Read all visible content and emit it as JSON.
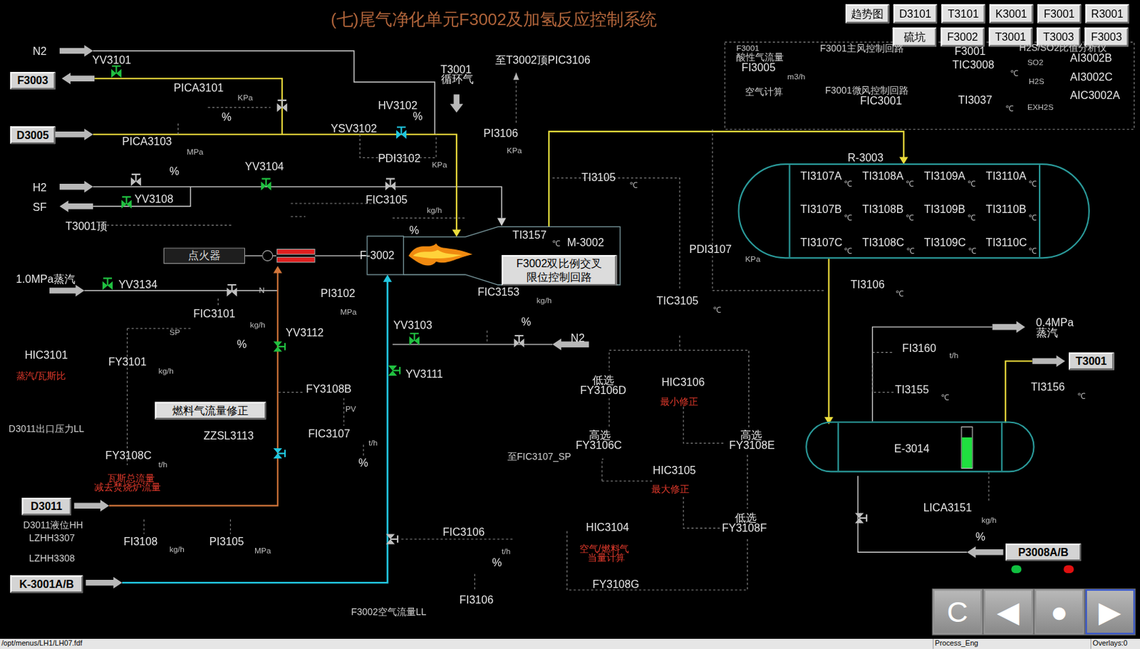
{
  "title": "(七)尾气净化单元F3002及加氢反应控制系统",
  "nav": [
    [
      "趋势图",
      "D3101",
      "T3101",
      "K3001",
      "F3001",
      "R3001"
    ],
    [
      "硫坑",
      "F3002",
      "T3001",
      "T3003",
      "F3003"
    ]
  ],
  "boxes": [
    {
      "lines": [
        "F3003"
      ],
      "kind": "stream"
    },
    {
      "lines": [
        "D3005"
      ],
      "kind": "stream"
    },
    {
      "lines": [
        "D3011"
      ],
      "kind": "stream"
    },
    {
      "lines": [
        "K-3001A/B"
      ],
      "kind": "stream"
    },
    {
      "lines": [
        "T3001"
      ],
      "kind": "stream"
    },
    {
      "lines": [
        "P3008A/B"
      ],
      "kind": "stream"
    },
    {
      "lines": [
        "点火器"
      ],
      "kind": "dark"
    },
    {
      "lines": [
        "燃料气流量修正"
      ],
      "kind": "light"
    },
    {
      "lines": [
        "F3002双比例交叉",
        "限位控制回路"
      ],
      "kind": "light"
    }
  ],
  "labels": [
    {
      "text": "N2",
      "kind": "tag"
    },
    {
      "text": "YV3101",
      "kind": "tag"
    },
    {
      "text": "PICA3101",
      "kind": "tag"
    },
    {
      "text": "KPa",
      "kind": "unit"
    },
    {
      "text": "%",
      "kind": "tag"
    },
    {
      "text": "PICA3103",
      "kind": "tag"
    },
    {
      "text": "MPa",
      "kind": "unit"
    },
    {
      "text": "%",
      "kind": "tag"
    },
    {
      "text": "HV3102",
      "kind": "tag"
    },
    {
      "text": "%",
      "kind": "tag"
    },
    {
      "text": "YSV3102",
      "kind": "tag"
    },
    {
      "text": "PDI3102",
      "kind": "tag"
    },
    {
      "text": "KPa",
      "kind": "unit"
    },
    {
      "text": "T3001",
      "kind": "tag"
    },
    {
      "text": "循环气",
      "kind": "tag"
    },
    {
      "text": "至T3002顶PIC3106",
      "kind": "tag"
    },
    {
      "text": "PI3106",
      "kind": "tag"
    },
    {
      "text": "KPa",
      "kind": "unit"
    },
    {
      "text": "H2",
      "kind": "tag"
    },
    {
      "text": "YV3104",
      "kind": "tag"
    },
    {
      "text": "SF",
      "kind": "tag"
    },
    {
      "text": "YV3108",
      "kind": "tag"
    },
    {
      "text": "FIC3105",
      "kind": "tag"
    },
    {
      "text": "kg/h",
      "kind": "unit"
    },
    {
      "text": "T3001顶",
      "kind": "tag"
    },
    {
      "text": "%",
      "kind": "tag"
    },
    {
      "text": "TI3157",
      "kind": "tag"
    },
    {
      "text": "℃",
      "kind": "unit"
    },
    {
      "text": "M-3002",
      "kind": "tag"
    },
    {
      "text": "F-3002",
      "kind": "tag"
    },
    {
      "text": "1.0MPa蒸汽",
      "kind": "tag"
    },
    {
      "text": "YV3134",
      "kind": "tag"
    },
    {
      "text": "N",
      "kind": "unit"
    },
    {
      "text": "PI3102",
      "kind": "tag"
    },
    {
      "text": "MPa",
      "kind": "unit"
    },
    {
      "text": "FIC3153",
      "kind": "tag"
    },
    {
      "text": "kg/h",
      "kind": "unit"
    },
    {
      "text": "FIC3101",
      "kind": "tag"
    },
    {
      "text": "kg/h",
      "kind": "unit"
    },
    {
      "text": "SP",
      "kind": "unit"
    },
    {
      "text": "%",
      "kind": "tag"
    },
    {
      "text": "YV3112",
      "kind": "tag"
    },
    {
      "text": "HIC3101",
      "kind": "tag"
    },
    {
      "text": "蒸汽/瓦斯比",
      "kind": "note"
    },
    {
      "text": "FY3101",
      "kind": "tag"
    },
    {
      "text": "kg/h",
      "kind": "unit"
    },
    {
      "text": "YV3103",
      "kind": "tag"
    },
    {
      "text": "%",
      "kind": "tag"
    },
    {
      "text": "N2",
      "kind": "tag"
    },
    {
      "text": "YV3111",
      "kind": "tag"
    },
    {
      "text": "FY3108B",
      "kind": "tag"
    },
    {
      "text": "PV",
      "kind": "unit"
    },
    {
      "text": "D3011出口压力LL",
      "kind": "small"
    },
    {
      "text": "ZZSL3113",
      "kind": "tag"
    },
    {
      "text": "FIC3107",
      "kind": "tag"
    },
    {
      "text": "t/h",
      "kind": "unit"
    },
    {
      "text": "%",
      "kind": "tag"
    },
    {
      "text": "FY3108C",
      "kind": "tag"
    },
    {
      "text": "t/h",
      "kind": "unit"
    },
    {
      "text": "瓦斯总流量",
      "kind": "note"
    },
    {
      "text": "减去焚烧炉流量",
      "kind": "note"
    },
    {
      "text": "D3011液位HH",
      "kind": "small"
    },
    {
      "text": "LZHH3307",
      "kind": "small"
    },
    {
      "text": "LZHH3308",
      "kind": "small"
    },
    {
      "text": "FI3108",
      "kind": "tag"
    },
    {
      "text": "kg/h",
      "kind": "unit"
    },
    {
      "text": "PI3105",
      "kind": "tag"
    },
    {
      "text": "MPa",
      "kind": "unit"
    },
    {
      "text": "FIC3106",
      "kind": "tag"
    },
    {
      "text": "t/h",
      "kind": "unit"
    },
    {
      "text": "%",
      "kind": "tag"
    },
    {
      "text": "FI3106",
      "kind": "tag"
    },
    {
      "text": "F3002空气流量LL",
      "kind": "small"
    },
    {
      "text": "HIC3104",
      "kind": "tag"
    },
    {
      "text": "空气/燃料气",
      "kind": "note"
    },
    {
      "text": "当量计算",
      "kind": "note"
    },
    {
      "text": "FY3108G",
      "kind": "tag"
    },
    {
      "text": "TI3105",
      "kind": "tag"
    },
    {
      "text": "℃",
      "kind": "unit"
    },
    {
      "text": "PDI3107",
      "kind": "tag"
    },
    {
      "text": "KPa",
      "kind": "unit"
    },
    {
      "text": "TIC3105",
      "kind": "tag"
    },
    {
      "text": "℃",
      "kind": "unit"
    },
    {
      "text": "低选",
      "kind": "tag"
    },
    {
      "text": "FY3106D",
      "kind": "tag"
    },
    {
      "text": "HIC3106",
      "kind": "tag"
    },
    {
      "text": "最小修正",
      "kind": "note"
    },
    {
      "text": "高选",
      "kind": "tag"
    },
    {
      "text": "FY3106C",
      "kind": "tag"
    },
    {
      "text": "至FIC3107_SP",
      "kind": "small"
    },
    {
      "text": "高选",
      "kind": "tag"
    },
    {
      "text": "FY3108E",
      "kind": "tag"
    },
    {
      "text": "HIC3105",
      "kind": "tag"
    },
    {
      "text": "最大修正",
      "kind": "note"
    },
    {
      "text": "低选",
      "kind": "tag"
    },
    {
      "text": "FY3108F",
      "kind": "tag"
    },
    {
      "text": "R-3003",
      "kind": "tag"
    },
    {
      "text": "TI3106",
      "kind": "tag"
    },
    {
      "text": "℃",
      "kind": "unit"
    },
    {
      "text": "FI3160",
      "kind": "tag"
    },
    {
      "text": "t/h",
      "kind": "unit"
    },
    {
      "text": "TI3155",
      "kind": "tag"
    },
    {
      "text": "℃",
      "kind": "unit"
    },
    {
      "text": "0.4MPa",
      "kind": "tag"
    },
    {
      "text": "蒸汽",
      "kind": "tag"
    },
    {
      "text": "TI3156",
      "kind": "tag"
    },
    {
      "text": "℃",
      "kind": "unit"
    },
    {
      "text": "E-3014",
      "kind": "tag"
    },
    {
      "text": "LICA3151",
      "kind": "tag"
    },
    {
      "text": "kg/h",
      "kind": "unit"
    },
    {
      "text": "%",
      "kind": "tag"
    },
    {
      "text": "F3001",
      "kind": "tiny"
    },
    {
      "text": "酸性气流量",
      "kind": "small"
    },
    {
      "text": "FI3005",
      "kind": "tag"
    },
    {
      "text": "m3/h",
      "kind": "unit"
    },
    {
      "text": "空气计算",
      "kind": "small"
    },
    {
      "text": "F3001主风控制回路",
      "kind": "small"
    },
    {
      "text": "F3001微风控制回路",
      "kind": "small"
    },
    {
      "text": "FIC3001",
      "kind": "tag"
    },
    {
      "text": "F3001",
      "kind": "tag"
    },
    {
      "text": "TIC3008",
      "kind": "tag"
    },
    {
      "text": "℃",
      "kind": "unit"
    },
    {
      "text": "TI3037",
      "kind": "tag"
    },
    {
      "text": "℃",
      "kind": "unit"
    },
    {
      "text": "H2S/SO2比值分析仪",
      "kind": "small"
    },
    {
      "text": "SO2",
      "kind": "unit"
    },
    {
      "text": "H2S",
      "kind": "unit"
    },
    {
      "text": "EXH2S",
      "kind": "unit"
    },
    {
      "text": "AI3002B",
      "kind": "tag"
    },
    {
      "text": "AI3002C",
      "kind": "tag"
    },
    {
      "text": "AIC3002A",
      "kind": "tag"
    }
  ],
  "reactor": {
    "temps": [
      [
        {
          "tag": "TI3107A",
          "unit": "℃"
        },
        {
          "tag": "TI3108A",
          "unit": "℃"
        },
        {
          "tag": "TI3109A",
          "unit": "℃"
        },
        {
          "tag": "TI3110A",
          "unit": "℃"
        }
      ],
      [
        {
          "tag": "TI3107B",
          "unit": "℃"
        },
        {
          "tag": "TI3108B",
          "unit": "℃"
        },
        {
          "tag": "TI3109B",
          "unit": "℃"
        },
        {
          "tag": "TI3110B",
          "unit": "℃"
        }
      ],
      [
        {
          "tag": "TI3107C",
          "unit": "℃"
        },
        {
          "tag": "TI3108C",
          "unit": "℃"
        },
        {
          "tag": "TI3109C",
          "unit": "℃"
        },
        {
          "tag": "TI3110C",
          "unit": "℃"
        }
      ]
    ]
  },
  "e3014_level": 0.75,
  "pump_lamps": [
    {
      "color": "#10c040"
    },
    {
      "color": "#e01010"
    }
  ],
  "controls": [
    {
      "label": "C",
      "selected": false
    },
    {
      "label": "◀",
      "selected": false
    },
    {
      "label": "●",
      "selected": false
    },
    {
      "label": "▶",
      "selected": true
    }
  ],
  "status_bar": [
    "/opt/menus/LH1/LH07.fdf",
    "Process_Eng",
    "Overlays:0"
  ]
}
